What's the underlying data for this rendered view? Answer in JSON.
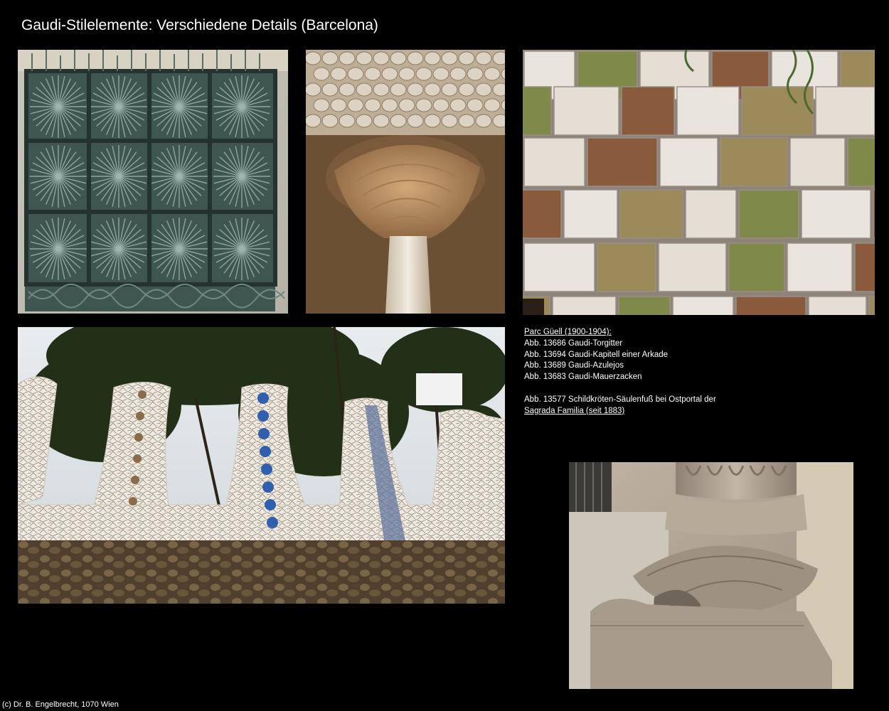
{
  "page": {
    "title": "Gaudi-Stilelemente: Verschiedene Details (Barcelona)",
    "copyright": "(c) Dr. B. Engelbrecht, 1070 Wien"
  },
  "captions": {
    "section_heading": "Parc Güell (1900-1904):",
    "items": [
      "Abb. 13686 Gaudi-Torgitter",
      "Abb. 13694 Gaudi-Kapitell einer Arkade",
      "Abb. 13689 Gaudi-Azulejos",
      "Abb. 13683 Gaudi-Mauerzacken"
    ],
    "extra_line1": "Abb. 13577 Schildkröten-Säulenfuß bei Ostportal der",
    "extra_line2": "Sagrada Familia (seit 1883)"
  },
  "colors": {
    "background": "#000000",
    "text": "#ffffff"
  }
}
